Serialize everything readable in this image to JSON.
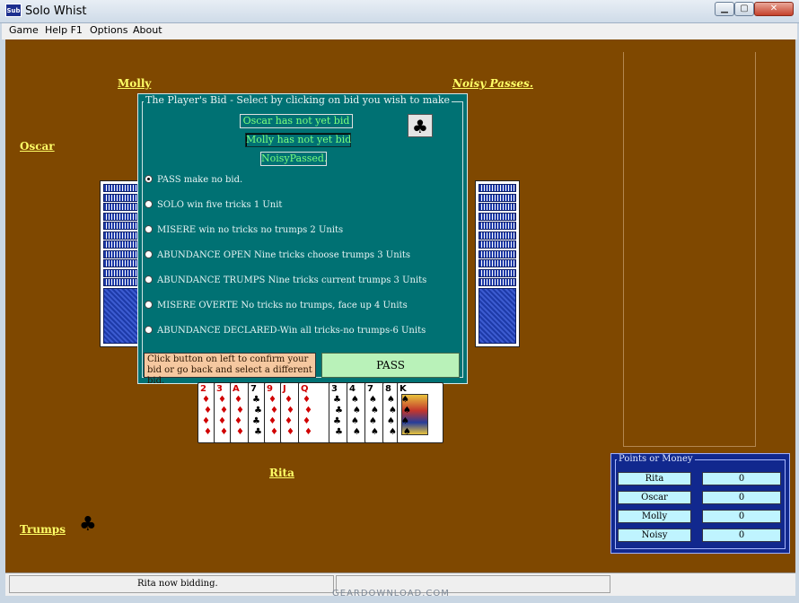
{
  "window": {
    "title": "Solo Whist",
    "icon_text": "Sub",
    "min": "▁",
    "max": "▢",
    "close": "✕"
  },
  "menu": [
    "Game",
    "Help F1",
    "Options",
    "About"
  ],
  "players": {
    "top_left": "Molly",
    "top_right": "Noisy Passes.",
    "left": "Oscar",
    "bottom": "Rita"
  },
  "trumps": {
    "label": "Trumps",
    "icon": "club-icon",
    "glyph": "♣"
  },
  "dialog": {
    "legend": "The Player's Bid - Select by clicking on bid  you wish to make",
    "status": [
      "Oscar has not yet bid",
      "Molly has not yet bid",
      "NoisyPassed."
    ],
    "trump_glyph": "♣",
    "options": [
      "PASS  make no bid.",
      "SOLO    win five tricks   1 Unit",
      "MISERE    win no tricks   no trumps   2 Units",
      "ABUNDANCE OPEN Nine tricks  choose trumps 3 Units",
      "ABUNDANCE TRUMPS Nine tricks  current trumps 3 Units",
      "MISERE OVERTE No  tricks   no trumps, face up   4 Units",
      "ABUNDANCE DECLARED-Win all tricks-no trumps-6 Units"
    ],
    "selected_index": 0,
    "hint": "Click button on left to confirm your bid or go back and select a different bid.",
    "confirm_label": "PASS"
  },
  "hand": [
    {
      "rank": "2",
      "suit": "♦",
      "color": "red"
    },
    {
      "rank": "3",
      "suit": "♦",
      "color": "red"
    },
    {
      "rank": "A",
      "suit": "♦",
      "color": "red"
    },
    {
      "rank": "7",
      "suit": "♣",
      "color": "black"
    },
    {
      "rank": "9",
      "suit": "♦",
      "color": "red"
    },
    {
      "rank": "J",
      "suit": "♦",
      "color": "red"
    },
    {
      "rank": "Q",
      "suit": "♦",
      "color": "red"
    },
    {
      "rank": "3",
      "suit": "♣",
      "color": "black"
    },
    {
      "rank": "4",
      "suit": "♠",
      "color": "black"
    },
    {
      "rank": "7",
      "suit": "♠",
      "color": "black"
    },
    {
      "rank": "8",
      "suit": "♠",
      "color": "black"
    },
    {
      "rank": "K",
      "suit": "♠",
      "color": "black"
    }
  ],
  "points": {
    "legend": "Points or Money",
    "rows": [
      {
        "name": "Rita",
        "value": "0"
      },
      {
        "name": "Oscar",
        "value": "0"
      },
      {
        "name": "Molly",
        "value": "0"
      },
      {
        "name": "Noisy",
        "value": "0"
      }
    ]
  },
  "statusbar": {
    "message": "Rita now bidding."
  },
  "watermark": "GEARDOWNLOAD.COM"
}
